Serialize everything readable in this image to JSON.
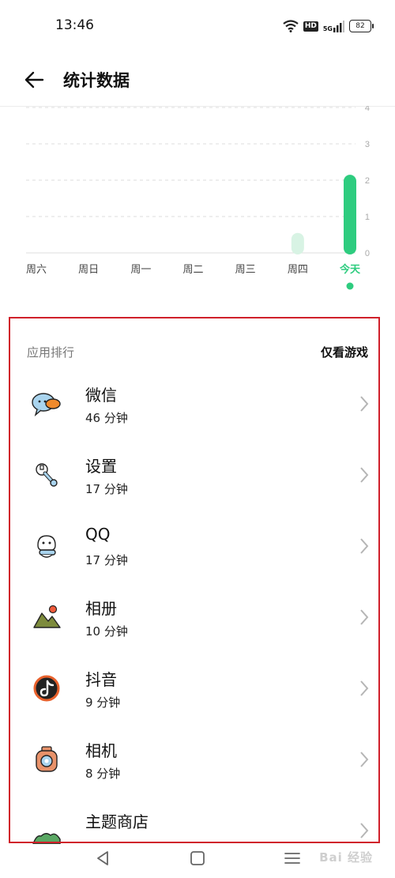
{
  "status_bar": {
    "time": "13:46",
    "hd": "HD",
    "network": "5G",
    "battery": "82"
  },
  "header": {
    "title": "统计数据"
  },
  "chart_data": {
    "type": "bar",
    "categories": [
      "周六",
      "周日",
      "周一",
      "周二",
      "周三",
      "周四",
      "今天"
    ],
    "values": [
      0,
      0,
      0,
      0,
      0,
      0.55,
      2.15
    ],
    "yticks": [
      "0",
      "1",
      "2",
      "3",
      "4"
    ],
    "ylim": [
      0,
      4
    ],
    "grid": true,
    "selected_index": 6,
    "colors": {
      "bar": "#d8f3e4",
      "selected": "#2ecc7f",
      "label": "#444444",
      "tick": "#aaaaaa",
      "grid": "#dddddd"
    }
  },
  "apps_section": {
    "title": "应用排行",
    "filter_label": "仅看游戏",
    "items": [
      {
        "name": "微信",
        "time": "46 分钟",
        "icon": "wechat-icon"
      },
      {
        "name": "设置",
        "time": "17 分钟",
        "icon": "settings-icon"
      },
      {
        "name": "QQ",
        "time": "17 分钟",
        "icon": "qq-icon"
      },
      {
        "name": "相册",
        "time": "10 分钟",
        "icon": "photos-icon"
      },
      {
        "name": "抖音",
        "time": "9 分钟",
        "icon": "douyin-icon"
      },
      {
        "name": "相机",
        "time": "8 分钟",
        "icon": "camera-icon"
      },
      {
        "name": "主题商店",
        "time": "",
        "icon": "theme-store-icon"
      }
    ]
  },
  "nav_bar": {
    "watermark": "Bai 经验"
  }
}
